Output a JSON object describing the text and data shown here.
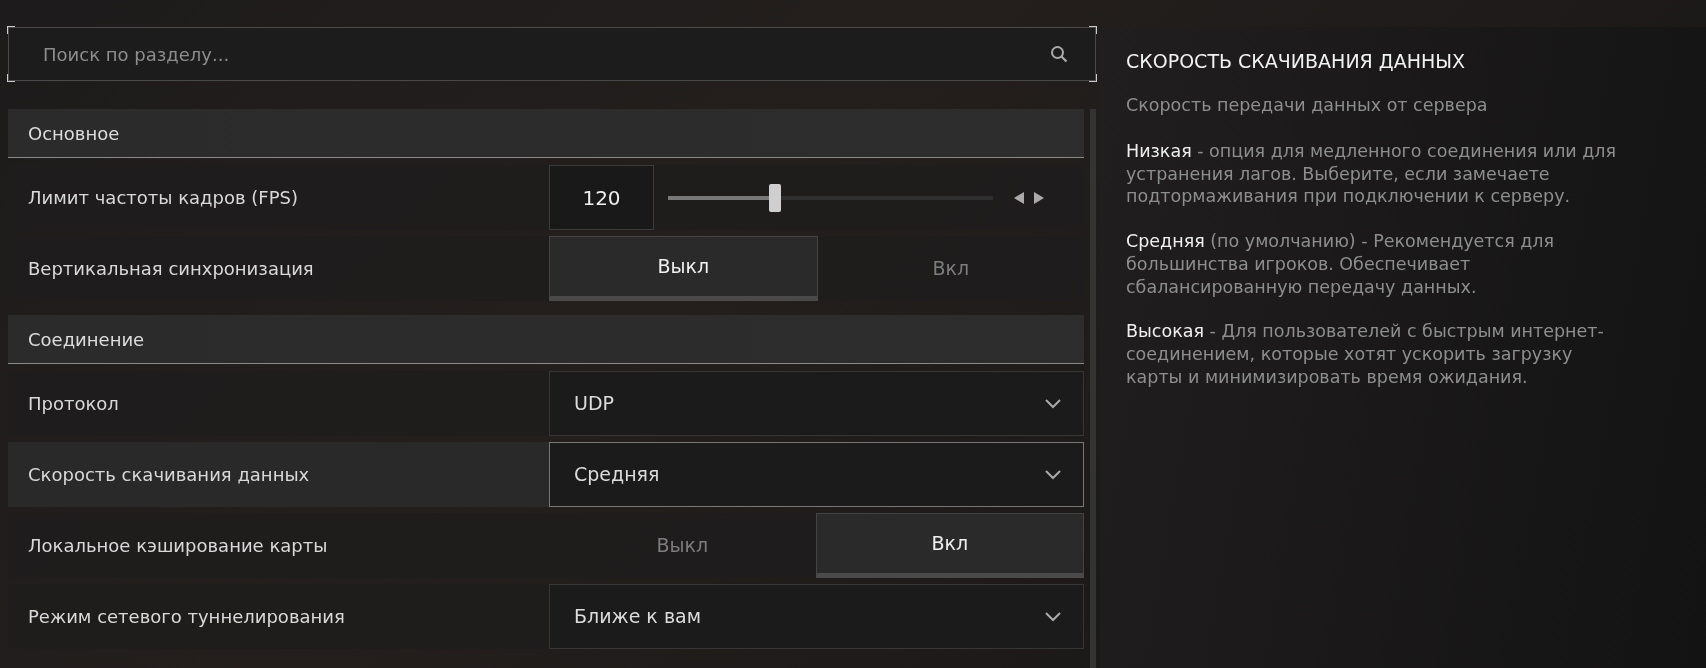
{
  "search": {
    "placeholder": "Поиск по разделу..."
  },
  "sections": [
    {
      "title": "Основное",
      "rows": [
        {
          "kind": "slider",
          "label": "Лимит частоты кадров (FPS)",
          "selected": false,
          "value": "120",
          "level": 0.33
        },
        {
          "kind": "toggle",
          "label": "Вертикальная синхронизация",
          "selected": false,
          "options": [
            {
              "label": "Выкл",
              "selected": true
            },
            {
              "label": "Вкл",
              "selected": false
            }
          ]
        }
      ]
    },
    {
      "title": "Соединение",
      "rows": [
        {
          "kind": "select",
          "label": "Протокол",
          "selected": false,
          "value": "UDP"
        },
        {
          "kind": "select",
          "label": "Скорость скачивания данных",
          "selected": true,
          "value": "Средняя"
        },
        {
          "kind": "toggle",
          "label": "Локальное кэширование карты",
          "selected": false,
          "options": [
            {
              "label": "Выкл",
              "selected": false
            },
            {
              "label": "Вкл",
              "selected": true
            }
          ]
        },
        {
          "kind": "select",
          "label": "Режим сетевого туннелирования",
          "selected": false,
          "value": "Ближе к вам"
        }
      ]
    }
  ],
  "details": {
    "title": "СКОРОСТЬ СКАЧИВАНИЯ ДАННЫХ",
    "subtitle": "Скорость передачи данных от сервера",
    "paragraphs": [
      {
        "term": "Низкая",
        "text": " - опция для медленного соединения или для устранения лагов. Выберите, если замечаете подтормаживания при подключении к серверу."
      },
      {
        "term": "Средняя",
        "text": " (по умолчанию) - Рекомендуется для большинства игроков. Обеспечивает сбалансированную передачу данных."
      },
      {
        "term": "Высокая",
        "text": " - Для пользователей с быстрым интернет-соединением, которые хотят ускорить загрузку карты и минимизировать время ожидания."
      }
    ]
  }
}
